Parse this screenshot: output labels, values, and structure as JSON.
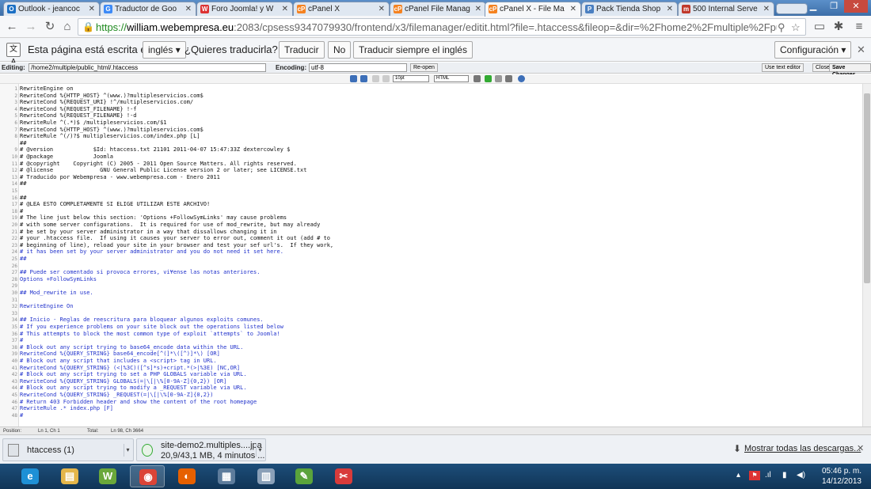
{
  "tabs": [
    {
      "title": "Outlook - jeancoc",
      "icon": "outlook-icon",
      "color": "#1a6fc4",
      "glyph": "O"
    },
    {
      "title": "Traductor de Goo",
      "icon": "translate-icon",
      "color": "#3d8af7",
      "glyph": "G"
    },
    {
      "title": "Foro Joomla! y W",
      "icon": "webempresa-icon",
      "color": "#d33",
      "glyph": "W"
    },
    {
      "title": "cPanel X",
      "icon": "cpanel-icon",
      "color": "#f58220",
      "glyph": "cP"
    },
    {
      "title": "cPanel File Manag",
      "icon": "cpanel-icon",
      "color": "#f58220",
      "glyph": "cP"
    },
    {
      "title": "cPanel X - File Ma",
      "icon": "cpanel-icon",
      "color": "#f58220",
      "glyph": "cP"
    },
    {
      "title": "Pack Tienda Shop",
      "icon": "shop-icon",
      "color": "#4a7fc1",
      "glyph": "P"
    },
    {
      "title": "500 Internal Serve",
      "icon": "error-page-icon",
      "color": "#c0392b",
      "glyph": "m"
    }
  ],
  "active_tab_index": 5,
  "address": {
    "https": "https://",
    "host": "william.webempresa.eu",
    "rest": ":2083/cpsess9347079930/frontend/x3/filemanager/editit.html?file=.htaccess&fileop=&dir=%2Fhome2%2Fmultiple%2Fpubl"
  },
  "translate": {
    "prompt": "Esta página está escrita en",
    "language": "inglés",
    "question": "¿Quieres traducirla?",
    "translate_btn": "Traducir",
    "no_btn": "No",
    "always_btn": "Traducir siempre el inglés",
    "config_btn": "Configuración"
  },
  "editor_header": {
    "editing_label": "Editing:",
    "path": "/home2/multiple/public_html/.htaccess",
    "encoding_label": "Encoding:",
    "encoding": "utf-8",
    "reopen": "Re-open",
    "use_text_editor": "Use text editor",
    "close": "Close",
    "save_changes": "Save Changes"
  },
  "code_lines": [
    {
      "n": "1",
      "t": "RewriteEngine on",
      "s": "normal"
    },
    {
      "n": "2",
      "t": "RewriteCond %{HTTP_HOST} ^(www.)?multipleservicios.com$",
      "s": "normal"
    },
    {
      "n": "3",
      "t": "RewriteCond %{REQUEST_URI} !^/multipleservicios.com/",
      "s": "normal"
    },
    {
      "n": "4",
      "t": "RewriteCond %{REQUEST_FILENAME} !-f",
      "s": "normal"
    },
    {
      "n": "5",
      "t": "RewriteCond %{REQUEST_FILENAME} !-d",
      "s": "normal"
    },
    {
      "n": "6",
      "t": "RewriteRule ^(.*)$ /multipleservicios.com/$1",
      "s": "normal"
    },
    {
      "n": "7",
      "t": "RewriteCond %{HTTP_HOST} ^(www.)?multipleservicios.com$",
      "s": "normal"
    },
    {
      "n": "8",
      "t": "RewriteRule ^(/)?$ multipleservicios.com/index.php [L]",
      "s": "normal"
    },
    {
      "n": "",
      "t": "##",
      "s": "normal"
    },
    {
      "n": "9",
      "t": "# @version            $Id: htaccess.txt 21101 2011-04-07 15:47:33Z dextercowley $",
      "s": "normal"
    },
    {
      "n": "10",
      "t": "# @package            Joomla",
      "s": "normal"
    },
    {
      "n": "11",
      "t": "# @copyright    Copyright (C) 2005 - 2011 Open Source Matters. All rights reserved.",
      "s": "normal"
    },
    {
      "n": "12",
      "t": "# @license              GNU General Public License version 2 or later; see LICENSE.txt",
      "s": "normal"
    },
    {
      "n": "13",
      "t": "# Traducido por Webempresa - www.webempresa.com - Enero 2011",
      "s": "normal"
    },
    {
      "n": "14",
      "t": "##",
      "s": "normal"
    },
    {
      "n": "15",
      "t": "",
      "s": "normal"
    },
    {
      "n": "16",
      "t": "##",
      "s": "normal"
    },
    {
      "n": "17",
      "t": "# @LEA ESTO COMPLETAMENTE SI ELIGE UTILIZAR ESTE ARCHIVO!",
      "s": "normal"
    },
    {
      "n": "18",
      "t": "#",
      "s": "normal"
    },
    {
      "n": "19",
      "t": "# The line just below this section: 'Options +FollowSymLinks' may cause problems",
      "s": "normal"
    },
    {
      "n": "20",
      "t": "# with some server configurations.  It is required for use of mod_rewrite, but may already",
      "s": "normal"
    },
    {
      "n": "21",
      "t": "# be set by your server administrator in a way that dissallows changing it in",
      "s": "normal"
    },
    {
      "n": "22",
      "t": "# your .htaccess file.  If using it causes your server to error out, comment it out (add # to",
      "s": "normal"
    },
    {
      "n": "23",
      "t": "# beginning of line), reload your site in your browser and test your sef url's.  If they work,",
      "s": "mixed"
    },
    {
      "n": "24",
      "t": "# it has been set by your server administrator and you do not need it set here.",
      "s": "blue"
    },
    {
      "n": "25",
      "t": "##",
      "s": "blue"
    },
    {
      "n": "26",
      "t": "",
      "s": "blue"
    },
    {
      "n": "27",
      "t": "## Puede ser comentado si provoca errores, vi¥ense las notas anteriores.",
      "s": "blue"
    },
    {
      "n": "28",
      "t": "Options +FollowSymLinks",
      "s": "blue"
    },
    {
      "n": "29",
      "t": "",
      "s": "blue"
    },
    {
      "n": "30",
      "t": "## Mod_rewrite in use.",
      "s": "blue"
    },
    {
      "n": "31",
      "t": "",
      "s": "blue"
    },
    {
      "n": "32",
      "t": "RewriteEngine On",
      "s": "blue"
    },
    {
      "n": "33",
      "t": "",
      "s": "blue"
    },
    {
      "n": "34",
      "t": "## Inicio - Reglas de reescritura para bloquear algunos exploits comunes.",
      "s": "blue"
    },
    {
      "n": "35",
      "t": "# If you experience problems on your site block out the operations listed below",
      "s": "blue"
    },
    {
      "n": "36",
      "t": "# This attempts to block the most common type of exploit `attempts` to Joomla!",
      "s": "blue"
    },
    {
      "n": "37",
      "t": "#",
      "s": "blue"
    },
    {
      "n": "38",
      "t": "# Block out any script trying to base64_encode data within the URL.",
      "s": "blue"
    },
    {
      "n": "39",
      "t": "RewriteCond %{QUERY_STRING} base64_encode[^(]*\\([^)]*\\) [OR]",
      "s": "blue"
    },
    {
      "n": "40",
      "t": "# Block out any script that includes a <script> tag in URL.",
      "s": "blue"
    },
    {
      "n": "41",
      "t": "RewriteCond %{QUERY_STRING} (<|%3C)([^s]*s)+cript.*(>|%3E) [NC,OR]",
      "s": "blue"
    },
    {
      "n": "42",
      "t": "# Block out any script trying to set a PHP GLOBALS variable via URL.",
      "s": "blue"
    },
    {
      "n": "43",
      "t": "RewriteCond %{QUERY_STRING} GLOBALS(=|\\[|\\%[0-9A-Z]{0,2}) [OR]",
      "s": "blue"
    },
    {
      "n": "44",
      "t": "# Block out any script trying to modify a _REQUEST variable via URL.",
      "s": "blue"
    },
    {
      "n": "45",
      "t": "RewriteCond %{QUERY_STRING} _REQUEST(=|\\[|\\%[0-9A-Z]{0,2})",
      "s": "blue"
    },
    {
      "n": "46",
      "t": "# Return 403 Forbidden header and show the content of the root homepage",
      "s": "blue"
    },
    {
      "n": "47",
      "t": "RewriteRule .* index.php [F]",
      "s": "blue"
    },
    {
      "n": "48",
      "t": "#",
      "s": "blue"
    }
  ],
  "status": {
    "position_label": "Position:",
    "position": "Ln 1, Ch 1",
    "total_label": "Total:",
    "total": "Ln 98, Ch 3664"
  },
  "downloads": [
    {
      "name": "htaccess (1)",
      "sub": ""
    },
    {
      "name": "site-demo2.multiples....jpa",
      "sub": "20,9/43,1 MB, 4 minutos ..."
    }
  ],
  "show_all_downloads": "Mostrar todas las descargas...",
  "taskbar_apps": [
    {
      "icon": "internet-explorer-icon",
      "color": "#1e90d6",
      "glyph": "e"
    },
    {
      "icon": "file-explorer-icon",
      "color": "#e4b64a",
      "glyph": "▤"
    },
    {
      "icon": "webmatrix-icon",
      "color": "#6aa83b",
      "glyph": "W"
    },
    {
      "icon": "chrome-icon",
      "color": "#db4437",
      "glyph": "◉"
    },
    {
      "icon": "firefox-icon",
      "color": "#e66000",
      "glyph": "◐"
    },
    {
      "icon": "network-icon",
      "color": "#5d7c9c",
      "glyph": "▦"
    },
    {
      "icon": "calculator-icon",
      "color": "#8aa0b8",
      "glyph": "▥"
    },
    {
      "icon": "notepad-icon",
      "color": "#5aa33b",
      "glyph": "✎"
    },
    {
      "icon": "snipping-tool-icon",
      "color": "#d83b3b",
      "glyph": "✂"
    }
  ],
  "active_taskbar_index": 3,
  "clock": {
    "time": "05:46 p. m.",
    "date": "14/12/2013"
  }
}
